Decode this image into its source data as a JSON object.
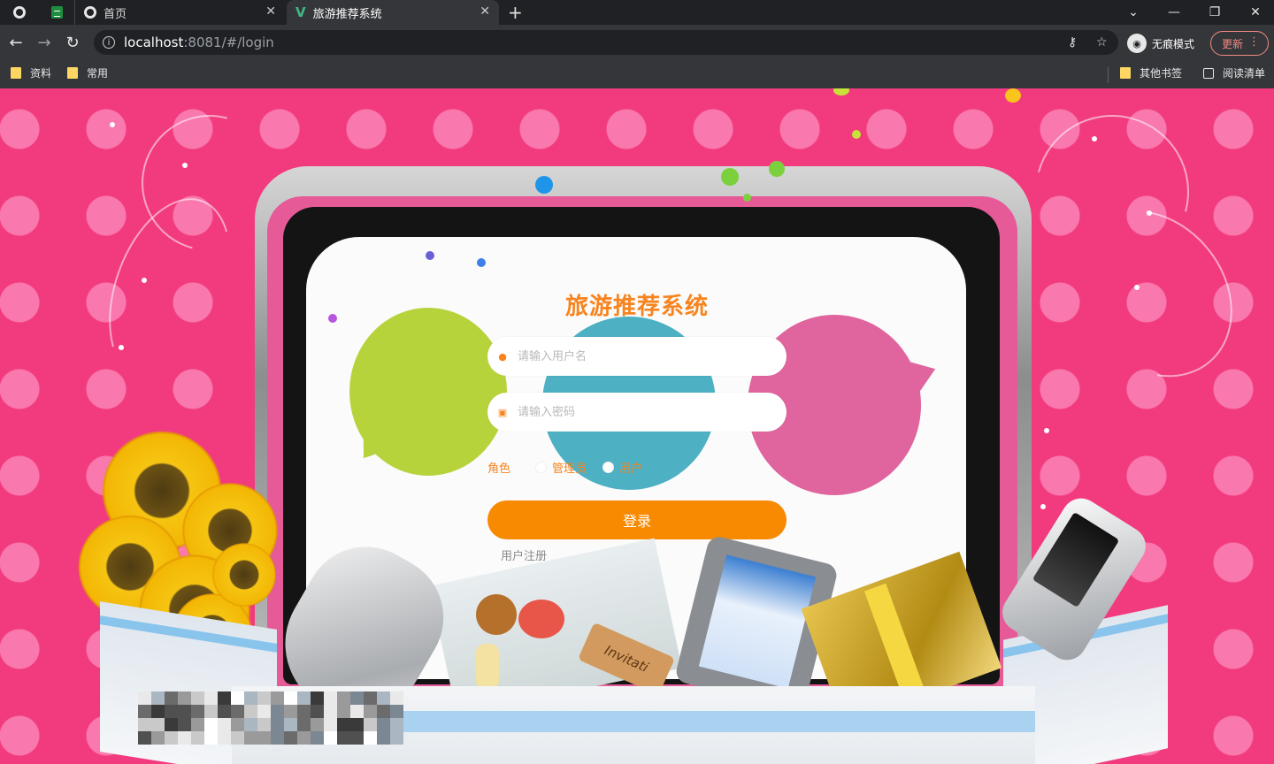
{
  "browser": {
    "tabs": [
      {
        "title": "首页",
        "active": false
      },
      {
        "title": "旅游推荐系统",
        "active": true
      }
    ],
    "new_tab_symbol": "+",
    "window_controls": {
      "menu": "⌄",
      "minimize": "—",
      "restore": "❐",
      "close": "✕"
    },
    "url_host": "localhost",
    "url_rest": ":8081/#/login",
    "incognito_label": "无痕模式",
    "update_label": "更新",
    "bookmarks": {
      "left": [
        "资料",
        "常用"
      ],
      "right": [
        "其他书签",
        "阅读清单"
      ]
    }
  },
  "login": {
    "title": "旅游推荐系统",
    "username_placeholder": "请输入用户名",
    "password_placeholder": "请输入密码",
    "role_label": "角色",
    "roles": [
      "管理员",
      "用户"
    ],
    "selected_role": "用户",
    "login_button": "登录",
    "register_link": "用户注册"
  },
  "decor": {
    "tag_text": "Invitati"
  },
  "colors": {
    "accent": "#f7841f",
    "button": "#f78a00",
    "background": "#f23b7e"
  }
}
